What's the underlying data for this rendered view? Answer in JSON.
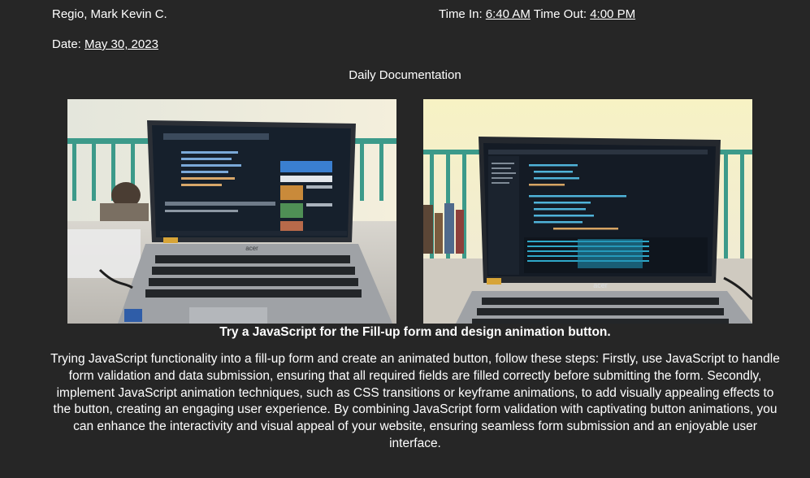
{
  "header": {
    "name": "Regio, Mark Kevin C.",
    "time_in_label": "Time In: ",
    "time_in": "6:40 AM",
    "time_out_label": " Time Out: ",
    "time_out": "4:00 PM",
    "date_label": "Date: ",
    "date": "May 30, 2023"
  },
  "document": {
    "title": "Daily Documentation",
    "activity_title": "Try a JavaScript for the Fill-up form and design animation button.",
    "body": "Trying JavaScript functionality into a fill-up form and create an animated button, follow these steps: Firstly, use JavaScript to handle form validation and data submission, ensuring that all required fields are filled correctly before submitting the form. Secondly, implement JavaScript animation techniques, such as CSS transitions or keyframe animations, to add visually appealing effects to the button, creating an engaging user experience. By combining JavaScript form validation with captivating button animations, you can enhance the interactivity and visual appeal of your website, ensuring seamless form submission and an enjoyable user interface."
  },
  "photos": {
    "brand_text": "acer",
    "colors": {
      "background": "#262626",
      "text": "#ffffff",
      "wall": "#e9e4d2",
      "railing": "#3c9a8a",
      "laptop_body": "#9fa2a6",
      "screen_dark": "#141b25",
      "code_blue": "#4fb3d9"
    }
  }
}
